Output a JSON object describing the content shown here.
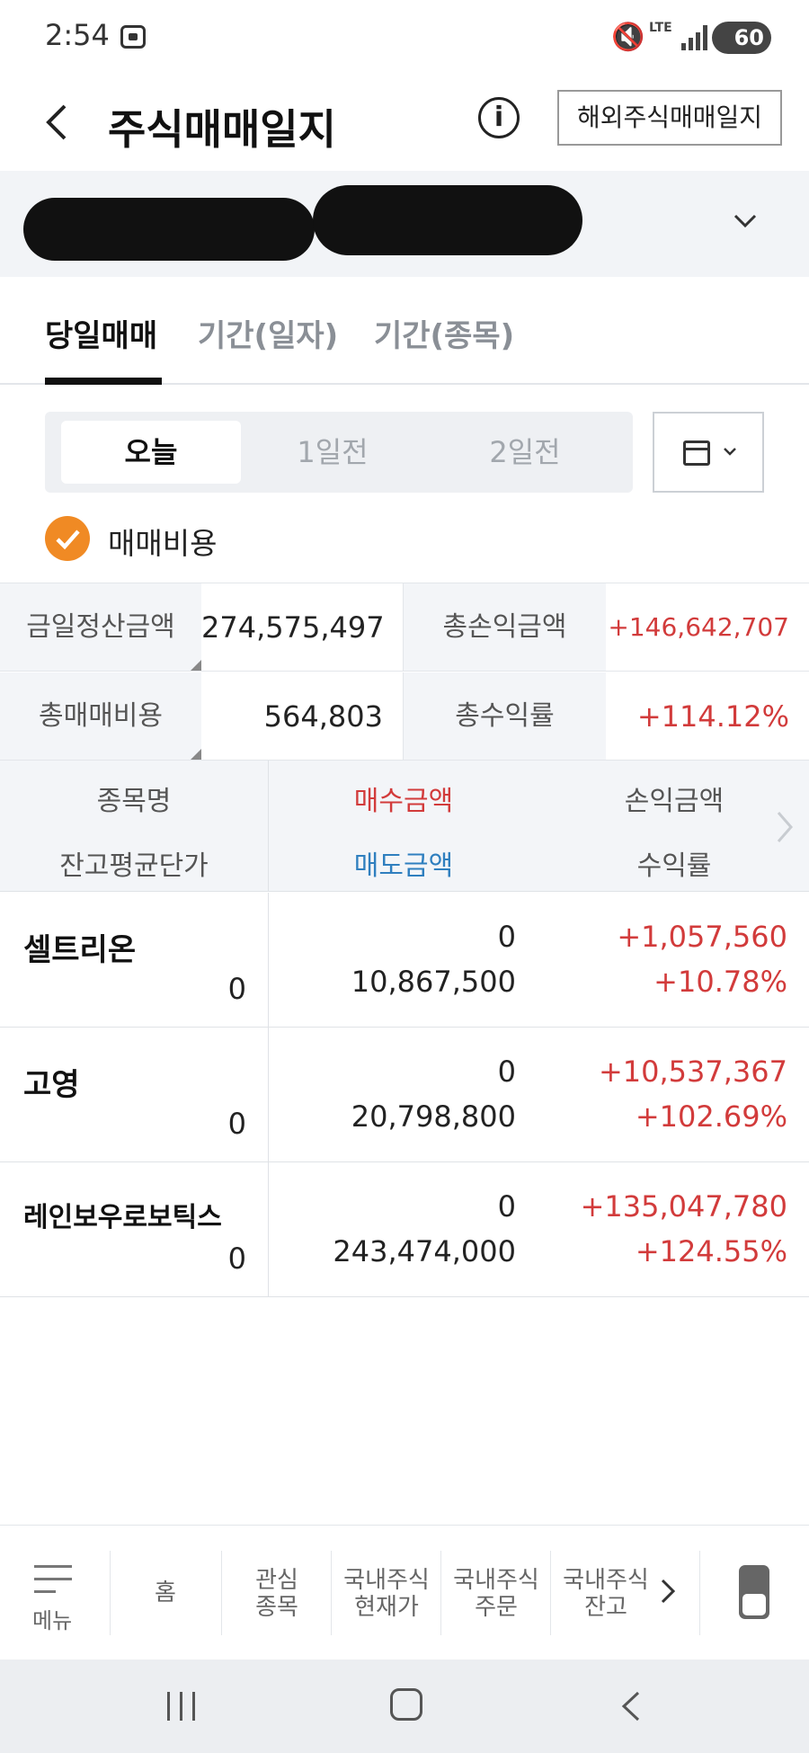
{
  "status_bar": {
    "time": "2:54",
    "network": "LTE",
    "battery": "60"
  },
  "header": {
    "title": "주식매매일지",
    "info_icon": "i",
    "overseas_button": "해외주식매매일지"
  },
  "tabs": [
    "당일매매",
    "기간(일자)",
    "기간(종목)"
  ],
  "day_selector": {
    "options": [
      "오늘",
      "1일전",
      "2일전"
    ],
    "selected": "오늘"
  },
  "fee_option": {
    "label": "매매비용",
    "checked": true
  },
  "summary": {
    "settlement_label": "금일정산금액",
    "settlement_value": "274,575,497",
    "total_pl_label": "총손익금액",
    "total_pl_value": "+146,642,707",
    "total_fee_label": "총매매비용",
    "total_fee_value": "564,803",
    "total_rate_label": "총수익률",
    "total_rate_value": "+114.12%"
  },
  "table": {
    "headers": {
      "name": "종목명",
      "avg_price": "잔고평균단가",
      "buy_amount": "매수금액",
      "sell_amount": "매도금액",
      "pl_amount": "손익금액",
      "return_rate": "수익률"
    },
    "rows": [
      {
        "name": "셀트리온",
        "avg_price": "0",
        "buy_amount": "0",
        "sell_amount": "10,867,500",
        "pl_amount": "+1,057,560",
        "return_rate": "+10.78%"
      },
      {
        "name": "고영",
        "avg_price": "0",
        "buy_amount": "0",
        "sell_amount": "20,798,800",
        "pl_amount": "+10,537,367",
        "return_rate": "+102.69%"
      },
      {
        "name": "레인보우로보틱스",
        "avg_price": "0",
        "buy_amount": "0",
        "sell_amount": "243,474,000",
        "pl_amount": "+135,047,780",
        "return_rate": "+124.55%"
      }
    ]
  },
  "bottom_nav": {
    "menu": "메뉴",
    "home": "홈",
    "watchlist": [
      "관심",
      "종목"
    ],
    "domestic_price": [
      "국내주식",
      "현재가"
    ],
    "domestic_order": [
      "국내주식",
      "주문"
    ],
    "domestic_balance": [
      "국내주식",
      "잔고"
    ]
  },
  "colors": {
    "accent_orange": "#f08a24",
    "profit_red": "#d23b3b",
    "sell_blue": "#2f7fbf"
  },
  "icons": [
    "back-icon",
    "info-icon",
    "chevron-down-icon",
    "calendar-icon",
    "check-icon",
    "chevron-right-icon",
    "menu-icon",
    "phone-icon"
  ]
}
